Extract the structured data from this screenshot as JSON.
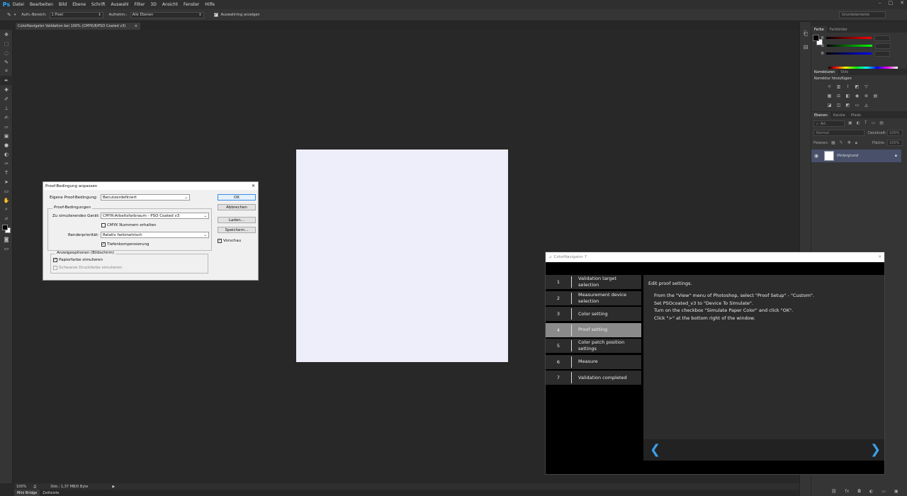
{
  "menubar": {
    "logo": "Ps",
    "items": [
      "Datei",
      "Bearbeiten",
      "Bild",
      "Ebene",
      "Schrift",
      "Auswahl",
      "Filter",
      "3D",
      "Ansicht",
      "Fenster",
      "Hilfe"
    ],
    "minimize": "–",
    "maximize": "□",
    "close": "✕"
  },
  "optbar": {
    "sample_size_label": "Aufn.-Bereich:",
    "sample_size_value": "1 Pixel",
    "sample_label": "Aufnehm.:",
    "sample_value": "Alle Ebenen",
    "show_ring_label": "Auswahlring anzeigen",
    "workspace": "Grundelemente"
  },
  "document": {
    "tab_title": "ColorNavigator Validation bei 100% (CMYK/8/PSO Coated v3)",
    "tab_close": "×",
    "canvas_color": "#eeeefb"
  },
  "statusbar": {
    "zoom": "100%",
    "doc_info": "Dok.: 1,37 MB/0 Byte",
    "tabs": [
      "Mini Bridge",
      "Zeitleiste"
    ]
  },
  "panels": {
    "color_tabs": [
      "Farbe",
      "Farbfelder"
    ],
    "color_channels": [
      "R",
      "G",
      "B"
    ],
    "adjust_tabs": [
      "Korrekturen",
      "Stile"
    ],
    "adjust_title": "Korrektur hinzufügen",
    "layers_tabs": [
      "Ebenen",
      "Kanäle",
      "Pfade"
    ],
    "layer_kind": "Art",
    "blend_mode": "Normal",
    "opacity_label": "Deckkraft:",
    "opacity_value": "100%",
    "fix_label": "Fixieren:",
    "fill_label": "Fläche:",
    "fill_value": "100%",
    "layer_name": "Hintergrund"
  },
  "proof_dialog": {
    "title": "Proof-Bedingung anpassen",
    "close": "✕",
    "custom_label": "Eigene Proof-Bedingung:",
    "custom_value": "Benutzerdefiniert",
    "group_label": "Proof-Bedingungen",
    "device_label": "Zu simulierendes Gerät:",
    "device_value": "CMYK-Arbeitsfarbraum - PSO Coated v3",
    "preserve_label": "CMYK  Nummern erhalten",
    "intent_label": "Renderpriorität:",
    "intent_value": "Relativ farbmetrisch",
    "bpc_label": "Tiefenkompensierung",
    "display_group_label": "Anzeigeoptionen (Bildschirm)",
    "paper_label": "Papierfarbe simulieren",
    "black_ink_label": "Schwarze Druckfarbe simulieren",
    "ok": "OK",
    "cancel": "Abbrechen",
    "load": "Laden...",
    "save": "Speichern...",
    "preview_label": "Vorschau"
  },
  "colornavigator": {
    "title": "ColorNavigator 7",
    "close": "✕",
    "steps": [
      {
        "num": "1",
        "label": "Validation target selection"
      },
      {
        "num": "2",
        "label": "Measurement device selection"
      },
      {
        "num": "3",
        "label": "Color setting"
      },
      {
        "num": "4",
        "label": "Proof setting"
      },
      {
        "num": "5",
        "label": "Color patch position settings"
      },
      {
        "num": "6",
        "label": "Measure"
      },
      {
        "num": "7",
        "label": "Validation completed"
      }
    ],
    "active_step": 4,
    "heading": "Edit proof settings.",
    "instructions": [
      "From the \"View\" menu of Photoshop, select \"Proof Setup\" - \"Custom\".",
      "Set PSOcoated_v3 to \"Device To Simulate\".",
      "Turn on the checkbox \"Simulate Paper Color\" and click \"OK\".",
      "Click \">\" at the bottom right of the window."
    ],
    "prev_arrow": "❮",
    "next_arrow": "❯",
    "accent": "#39a0e8"
  }
}
